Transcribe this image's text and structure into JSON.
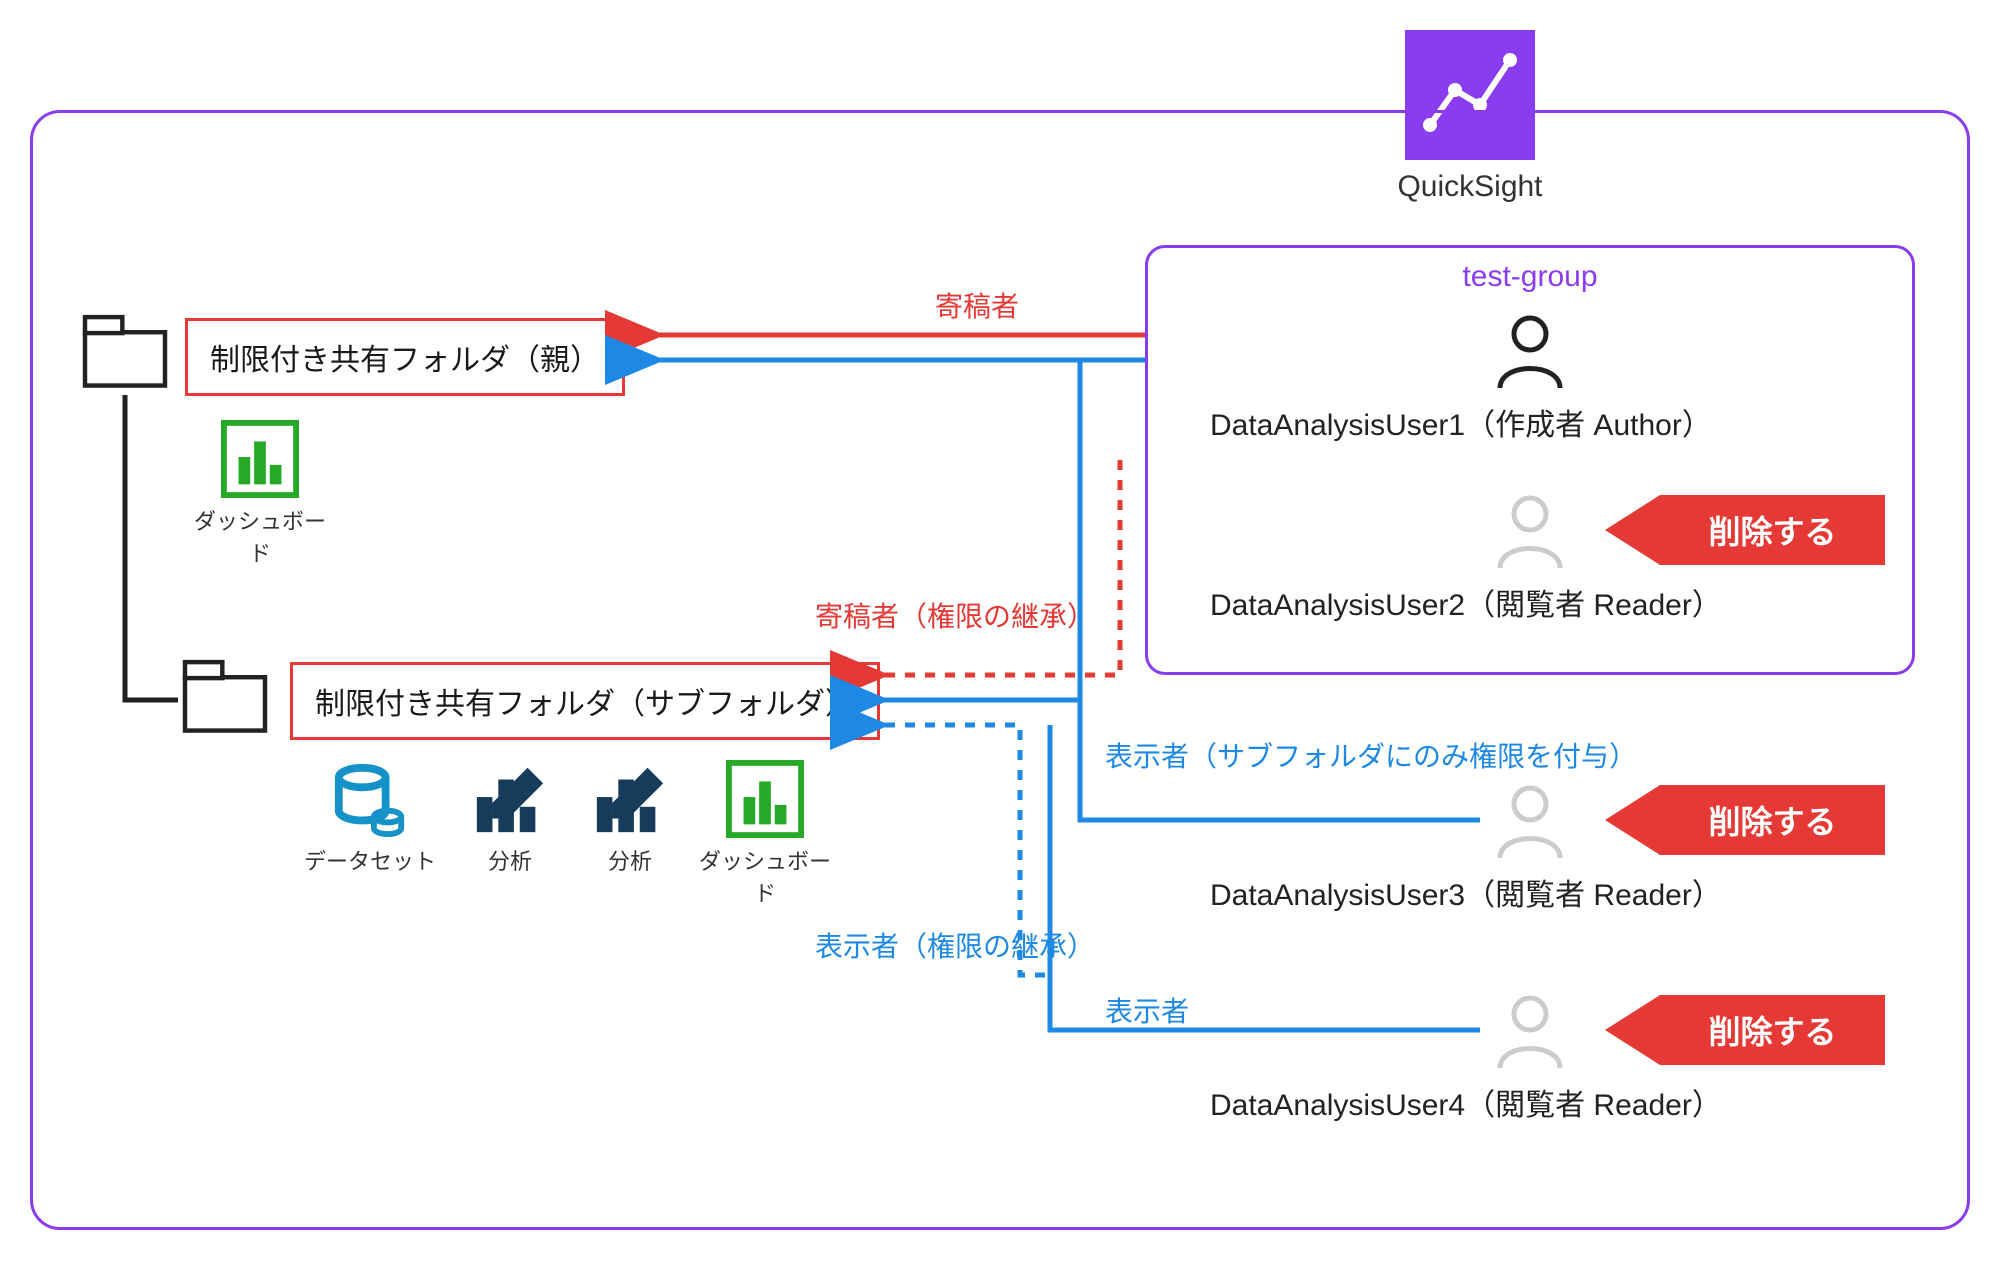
{
  "service": {
    "name": "QuickSight"
  },
  "group": {
    "name": "test-group"
  },
  "folders": {
    "parent": {
      "label": "制限付き共有フォルダ（親）"
    },
    "sub": {
      "label": "制限付き共有フォルダ（サブフォルダ）"
    }
  },
  "assets": {
    "dashboard": "ダッシュボード",
    "dataset": "データセット",
    "analysis": "分析"
  },
  "users": {
    "u1": {
      "name": "DataAnalysisUser1（作成者 Author）"
    },
    "u2": {
      "name": "DataAnalysisUser2（閲覧者 Reader）"
    },
    "u3": {
      "name": "DataAnalysisUser3（閲覧者 Reader）"
    },
    "u4": {
      "name": "DataAnalysisUser4（閲覧者 Reader）"
    }
  },
  "flows": {
    "contributor": "寄稿者",
    "contributor_inherited": "寄稿者（権限の継承）",
    "viewer_sub_only": "表示者（サブフォルダにのみ権限を付与）",
    "viewer_inherited": "表示者（権限の継承）",
    "viewer": "表示者"
  },
  "actions": {
    "delete": "削除する"
  },
  "colors": {
    "purple": "#8a3cf0",
    "red": "#e53935",
    "blue": "#1e88e5",
    "green": "#26a926",
    "cyan": "#1593c8",
    "navy": "#163b5b"
  }
}
